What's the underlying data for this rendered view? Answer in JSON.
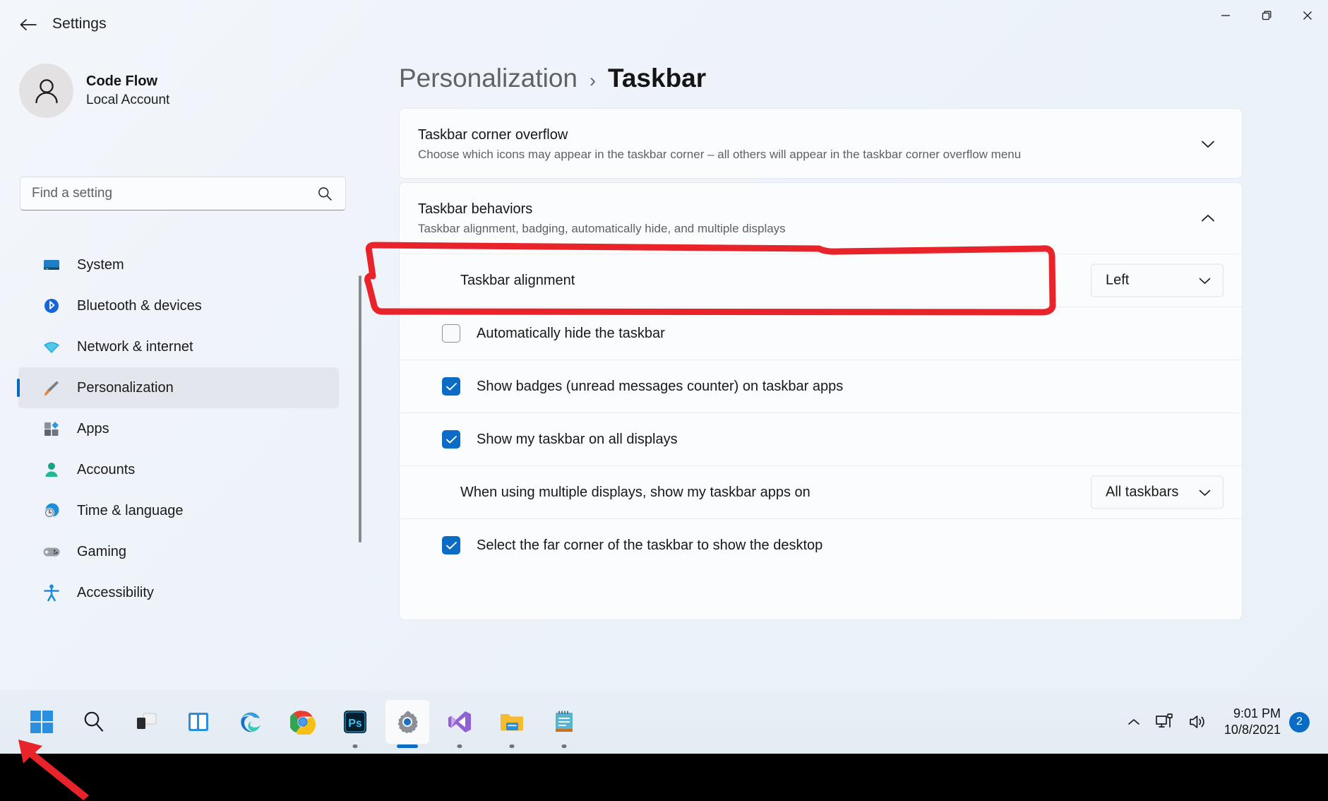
{
  "window": {
    "title": "Settings",
    "back_icon": "back-arrow-icon",
    "controls": {
      "minimize": "minimize-icon",
      "maximize": "maximize-icon",
      "close": "close-icon"
    }
  },
  "sidebar": {
    "account": {
      "name": "Code Flow",
      "subtitle": "Local Account",
      "avatar_icon": "person-avatar-icon"
    },
    "search": {
      "placeholder": "Find a setting",
      "icon": "search-icon",
      "value": ""
    },
    "items": [
      {
        "label": "System",
        "icon": "system-monitor-icon",
        "active": false
      },
      {
        "label": "Bluetooth & devices",
        "icon": "bluetooth-icon",
        "active": false
      },
      {
        "label": "Network & internet",
        "icon": "wifi-icon",
        "active": false
      },
      {
        "label": "Personalization",
        "icon": "paintbrush-icon",
        "active": true
      },
      {
        "label": "Apps",
        "icon": "apps-grid-icon",
        "active": false
      },
      {
        "label": "Accounts",
        "icon": "person-icon",
        "active": false
      },
      {
        "label": "Time & language",
        "icon": "clock-globe-icon",
        "active": false
      },
      {
        "label": "Gaming",
        "icon": "gamepad-icon",
        "active": false
      },
      {
        "label": "Accessibility",
        "icon": "accessibility-person-icon",
        "active": false
      }
    ]
  },
  "main": {
    "breadcrumb": {
      "parent": "Personalization",
      "separator": "›",
      "current": "Taskbar"
    },
    "cards": {
      "corner_overflow": {
        "title": "Taskbar corner overflow",
        "subtitle": "Choose which icons may appear in the taskbar corner – all others will appear in the taskbar corner overflow menu",
        "chevron_icon": "chevron-down-icon",
        "expanded": false
      },
      "behaviors": {
        "title": "Taskbar behaviors",
        "subtitle": "Taskbar alignment, badging, automatically hide, and multiple displays",
        "chevron_icon": "chevron-up-icon",
        "expanded": true,
        "rows": [
          {
            "type": "dropdown",
            "label": "Taskbar alignment",
            "value": "Left",
            "chevron_icon": "chevron-down-icon",
            "highlighted": true
          },
          {
            "type": "checkbox",
            "label": "Automatically hide the taskbar",
            "checked": false
          },
          {
            "type": "checkbox",
            "label": "Show badges (unread messages counter) on taskbar apps",
            "checked": true
          },
          {
            "type": "checkbox",
            "label": "Show my taskbar on all displays",
            "checked": true
          },
          {
            "type": "dropdown",
            "label": "When using multiple displays, show my taskbar apps on",
            "value": "All taskbars",
            "chevron_icon": "chevron-down-icon",
            "highlighted": false
          },
          {
            "type": "checkbox",
            "label": "Select the far corner of the taskbar to show the desktop",
            "checked": true
          }
        ]
      }
    }
  },
  "annotations": {
    "highlight_box": {
      "color": "#e8242a",
      "target": "Taskbar alignment"
    },
    "start_arrow": {
      "color": "#e8242a",
      "target": "start-button"
    }
  },
  "taskbar": {
    "apps": [
      {
        "name": "start-button",
        "icon": "windows-logo-icon",
        "active": false,
        "running": false
      },
      {
        "name": "search-button",
        "icon": "search-icon",
        "active": false,
        "running": false
      },
      {
        "name": "task-view-button",
        "icon": "task-view-icon",
        "active": false,
        "running": false
      },
      {
        "name": "widgets-button",
        "icon": "widgets-icon",
        "active": false,
        "running": false
      },
      {
        "name": "microsoft-edge",
        "icon": "edge-icon",
        "active": false,
        "running": false
      },
      {
        "name": "google-chrome",
        "icon": "chrome-icon",
        "active": false,
        "running": true
      },
      {
        "name": "adobe-photoshop",
        "icon": "photoshop-icon",
        "active": false,
        "running": true
      },
      {
        "name": "settings",
        "icon": "settings-gear-icon",
        "active": true,
        "running": true
      },
      {
        "name": "visual-studio",
        "icon": "visual-studio-icon",
        "active": false,
        "running": true
      },
      {
        "name": "file-explorer",
        "icon": "folder-icon",
        "active": false,
        "running": true
      },
      {
        "name": "notepad",
        "icon": "notepad-icon",
        "active": false,
        "running": true
      }
    ],
    "tray": {
      "overflow_icon": "chevron-up-icon",
      "network_icon": "network-monitor-icon",
      "volume_icon": "speaker-icon",
      "time": "9:01 PM",
      "date": "10/8/2021",
      "notification_count": "2"
    }
  }
}
